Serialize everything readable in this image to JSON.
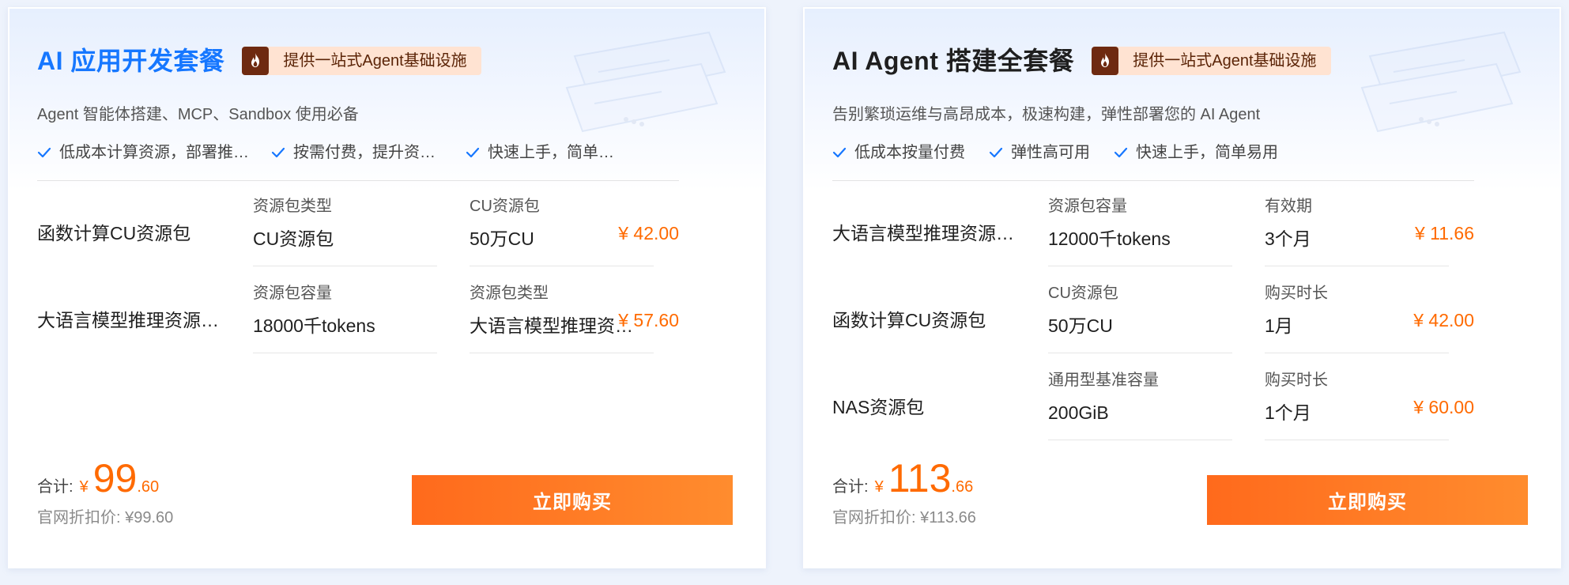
{
  "cards": [
    {
      "title": "AI 应用开发套餐",
      "badge": "提供一站式Agent基础设施",
      "subtitle": "Agent 智能体搭建、MCP、Sandbox 使用必备",
      "features": [
        "低成本计算资源，部署推理…",
        "按需付费，提升资源利…",
        "快速上手，简单…"
      ],
      "rows": [
        {
          "name": "函数计算CU资源包",
          "spec1_label": "资源包类型",
          "spec1_value": "CU资源包",
          "spec2_label": "CU资源包",
          "spec2_value": "50万CU",
          "price": "¥ 42.00"
        },
        {
          "name": "大语言模型推理资源…",
          "spec1_label": "资源包容量",
          "spec1_value": "18000千tokens",
          "spec2_label": "资源包类型",
          "spec2_value": "大语言模型推理资…",
          "price": "¥ 57.60"
        }
      ],
      "total_label": "合计:",
      "currency": "¥",
      "total_int": "99",
      "total_dec": ".60",
      "original_price": "官网折扣价: ¥99.60",
      "buy_label": "立即购买"
    },
    {
      "title": "AI Agent 搭建全套餐",
      "badge": "提供一站式Agent基础设施",
      "subtitle": "告别繁琐运维与高昂成本，极速构建，弹性部署您的 AI Agent",
      "features": [
        "低成本按量付费",
        "弹性高可用",
        "快速上手，简单易用"
      ],
      "rows": [
        {
          "name": "大语言模型推理资源…",
          "spec1_label": "资源包容量",
          "spec1_value": "12000千tokens",
          "spec2_label": "有效期",
          "spec2_value": "3个月",
          "price": "¥ 11.66"
        },
        {
          "name": "函数计算CU资源包",
          "spec1_label": "CU资源包",
          "spec1_value": "50万CU",
          "spec2_label": "购买时长",
          "spec2_value": "1月",
          "price": "¥ 42.00"
        },
        {
          "name": "NAS资源包",
          "spec1_label": "通用型基准容量",
          "spec1_value": "200GiB",
          "spec2_label": "购买时长",
          "spec2_value": "1个月",
          "price": "¥ 60.00"
        }
      ],
      "total_label": "合计:",
      "currency": "¥",
      "total_int": "113",
      "total_dec": ".66",
      "original_price": "官网折扣价: ¥113.66",
      "buy_label": "立即购买"
    }
  ],
  "colors": {
    "accent": "#ff6a00",
    "title_blue": "#1677ff",
    "check": "#1677ff",
    "badge_bg": "#ffe3d2",
    "badge_icon_bg": "#6e2a10"
  },
  "icons": {
    "badge": "flame-icon",
    "feature": "check-icon"
  }
}
